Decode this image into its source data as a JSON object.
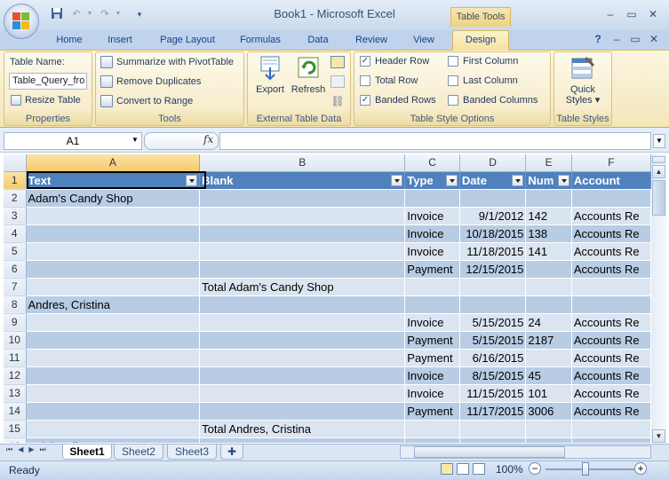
{
  "app": {
    "title": "Book1 - Microsoft Excel",
    "context_tab": "Table Tools"
  },
  "tabs": [
    "Home",
    "Insert",
    "Page Layout",
    "Formulas",
    "Data",
    "Review",
    "View"
  ],
  "active_tab": "Design",
  "ribbon": {
    "properties": {
      "table_name_label": "Table Name:",
      "table_name_value": "Table_Query_fro",
      "resize": "Resize Table",
      "group": "Properties"
    },
    "tools": {
      "pivot": "Summarize with PivotTable",
      "dupes": "Remove Duplicates",
      "range": "Convert to Range",
      "group": "Tools"
    },
    "external": {
      "export": "Export",
      "refresh": "Refresh",
      "group": "External Table Data"
    },
    "options": {
      "header_row": "Header Row",
      "total_row": "Total Row",
      "banded_rows": "Banded Rows",
      "first_col": "First Column",
      "last_col": "Last Column",
      "banded_cols": "Banded Columns",
      "group": "Table Style Options"
    },
    "styles": {
      "quick1": "Quick",
      "quick2": "Styles",
      "group": "Table Styles"
    }
  },
  "formula": {
    "name_box": "A1",
    "fx": "fx",
    "content": ""
  },
  "columns": [
    "A",
    "B",
    "C",
    "D",
    "E",
    "F"
  ],
  "headers": [
    "Text",
    "Blank",
    "Type",
    "Date",
    "Num",
    "Account"
  ],
  "rows": [
    {
      "n": "2",
      "cells": [
        "Adam's Candy Shop",
        "",
        "",
        "",
        "",
        ""
      ]
    },
    {
      "n": "3",
      "cells": [
        "",
        "",
        "Invoice",
        "9/1/2012",
        "142",
        "Accounts Re"
      ]
    },
    {
      "n": "4",
      "cells": [
        "",
        "",
        "Invoice",
        "10/18/2015",
        "138",
        "Accounts Re"
      ]
    },
    {
      "n": "5",
      "cells": [
        "",
        "",
        "Invoice",
        "11/18/2015",
        "141",
        "Accounts Re"
      ]
    },
    {
      "n": "6",
      "cells": [
        "",
        "",
        "Payment",
        "12/15/2015",
        "",
        "Accounts Re"
      ]
    },
    {
      "n": "7",
      "cells": [
        "",
        "Total Adam's Candy Shop",
        "",
        "",
        "",
        ""
      ]
    },
    {
      "n": "8",
      "cells": [
        "Andres, Cristina",
        "",
        "",
        "",
        "",
        ""
      ]
    },
    {
      "n": "9",
      "cells": [
        "",
        "",
        "Invoice",
        "5/15/2015",
        "24",
        "Accounts Re"
      ]
    },
    {
      "n": "10",
      "cells": [
        "",
        "",
        "Payment",
        "5/15/2015",
        "2187",
        "Accounts Re"
      ]
    },
    {
      "n": "11",
      "cells": [
        "",
        "",
        "Payment",
        "6/16/2015",
        "",
        "Accounts Re"
      ]
    },
    {
      "n": "12",
      "cells": [
        "",
        "",
        "Invoice",
        "8/15/2015",
        "45",
        "Accounts Re"
      ]
    },
    {
      "n": "13",
      "cells": [
        "",
        "",
        "Invoice",
        "11/15/2015",
        "101",
        "Accounts Re"
      ]
    },
    {
      "n": "14",
      "cells": [
        "",
        "",
        "Payment",
        "11/17/2015",
        "3006",
        "Accounts Re"
      ]
    },
    {
      "n": "15",
      "cells": [
        "",
        "Total Andres, Cristina",
        "",
        "",
        "",
        ""
      ]
    },
    {
      "n": "16",
      "cells": [
        "Balak, Mike",
        "",
        "",
        "",
        "",
        ""
      ]
    }
  ],
  "sheets": [
    "Sheet1",
    "Sheet2",
    "Sheet3"
  ],
  "status": {
    "ready": "Ready",
    "zoom": "100%"
  },
  "colors": {
    "table_header": "#4f81bd",
    "band_dark": "#b8cce4",
    "band_light": "#dbe5f1"
  }
}
